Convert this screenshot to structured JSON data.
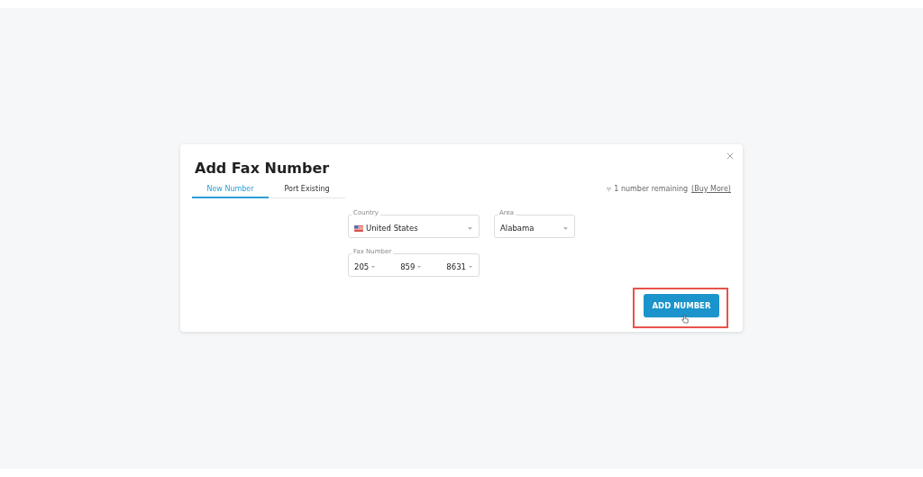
{
  "dialog": {
    "title": "Add Fax Number",
    "tabs": [
      {
        "label": "New Number",
        "selected": true
      },
      {
        "label": "Port Existing",
        "selected": false
      }
    ],
    "remaining": {
      "text": "1 number remaining",
      "link": "(Buy More)"
    },
    "country": {
      "label": "Country",
      "value": "United States"
    },
    "area": {
      "label": "Area",
      "value": "Alabama"
    },
    "fax_number": {
      "label": "Fax Number",
      "parts": [
        "205",
        "859",
        "8631"
      ]
    },
    "button": {
      "label": "ADD NUMBER",
      "highlighted": true
    }
  }
}
